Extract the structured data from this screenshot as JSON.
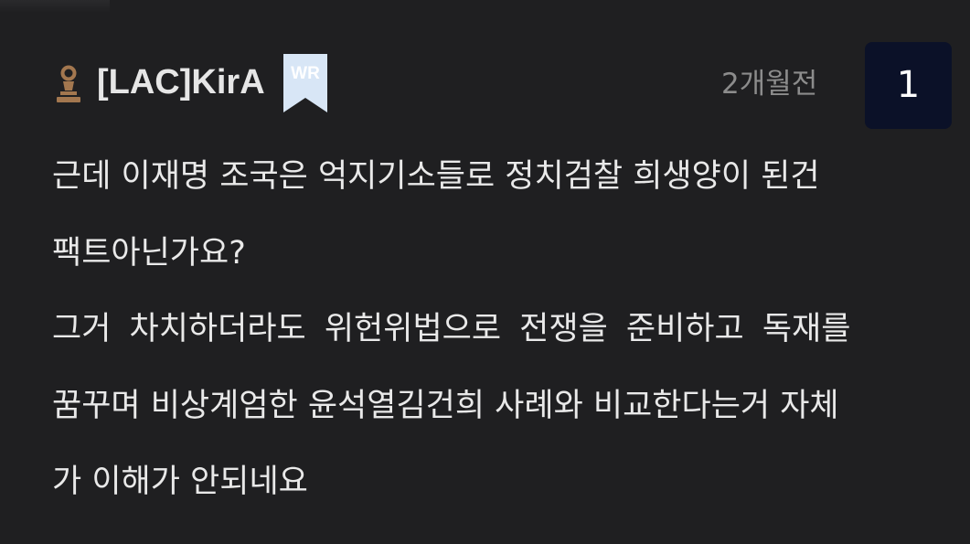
{
  "comment": {
    "author": "[LAC]KirA",
    "role_badge": "WR",
    "time_ago": "2개월전",
    "reply_count": "1",
    "lines": [
      "근데 이재명 조국은 억지기소들로 정치검찰 희생양이 된건",
      "팩트아닌가요?",
      "그거 차치하더라도 위헌위법으로 전쟁을 준비하고 독재를",
      "꿈꾸며 비상계엄한 윤석열김건희 사례와 비교한다는거 자체",
      "가 이해가 안되네요"
    ]
  },
  "icons": {
    "level": "pawn-icon",
    "role": "bookmark-badge-icon"
  },
  "colors": {
    "background": "#1f1f21",
    "text": "#e9e9e9",
    "timestamp": "#8c8c8c",
    "level_icon": "#a3774f",
    "badge_bookmark": "#d8e6f6",
    "reply_box": "#0b1128"
  }
}
